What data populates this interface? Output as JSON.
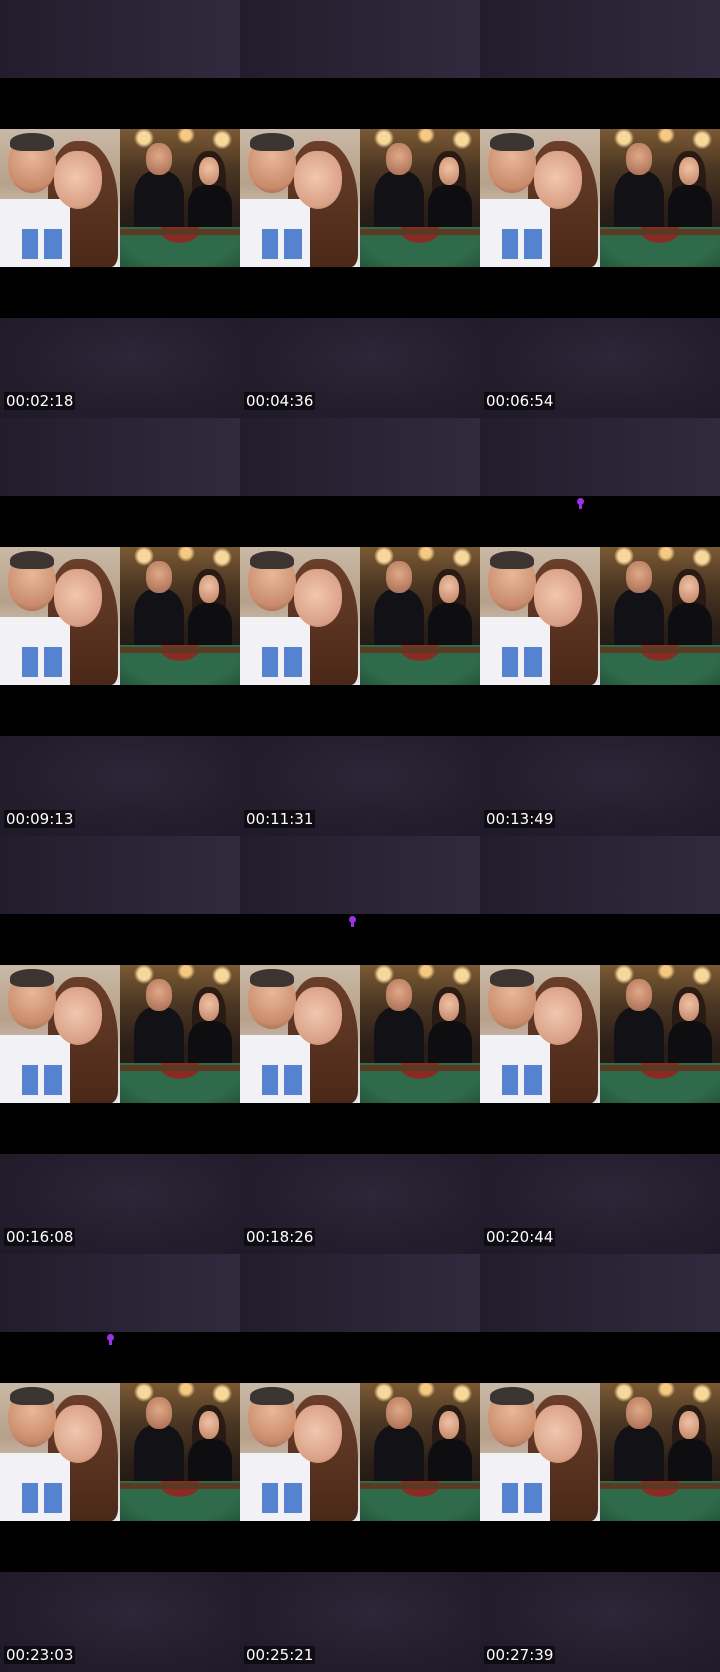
{
  "thumbnails": [
    {
      "timestamp": "00:02:18",
      "marker": false
    },
    {
      "timestamp": "00:04:36",
      "marker": false
    },
    {
      "timestamp": "00:06:54",
      "marker": false
    },
    {
      "timestamp": "00:09:13",
      "marker": false
    },
    {
      "timestamp": "00:11:31",
      "marker": false
    },
    {
      "timestamp": "00:13:49",
      "marker": true
    },
    {
      "timestamp": "00:16:08",
      "marker": false
    },
    {
      "timestamp": "00:18:26",
      "marker": true
    },
    {
      "timestamp": "00:20:44",
      "marker": false
    },
    {
      "timestamp": "00:23:03",
      "marker": true
    },
    {
      "timestamp": "00:25:21",
      "marker": false
    },
    {
      "timestamp": "00:27:39",
      "marker": false
    }
  ],
  "colors": {
    "marker": "#9b32e6",
    "letterbox": "#000000",
    "background": "#262030"
  },
  "icons": {
    "marker": "location-pin-icon"
  }
}
